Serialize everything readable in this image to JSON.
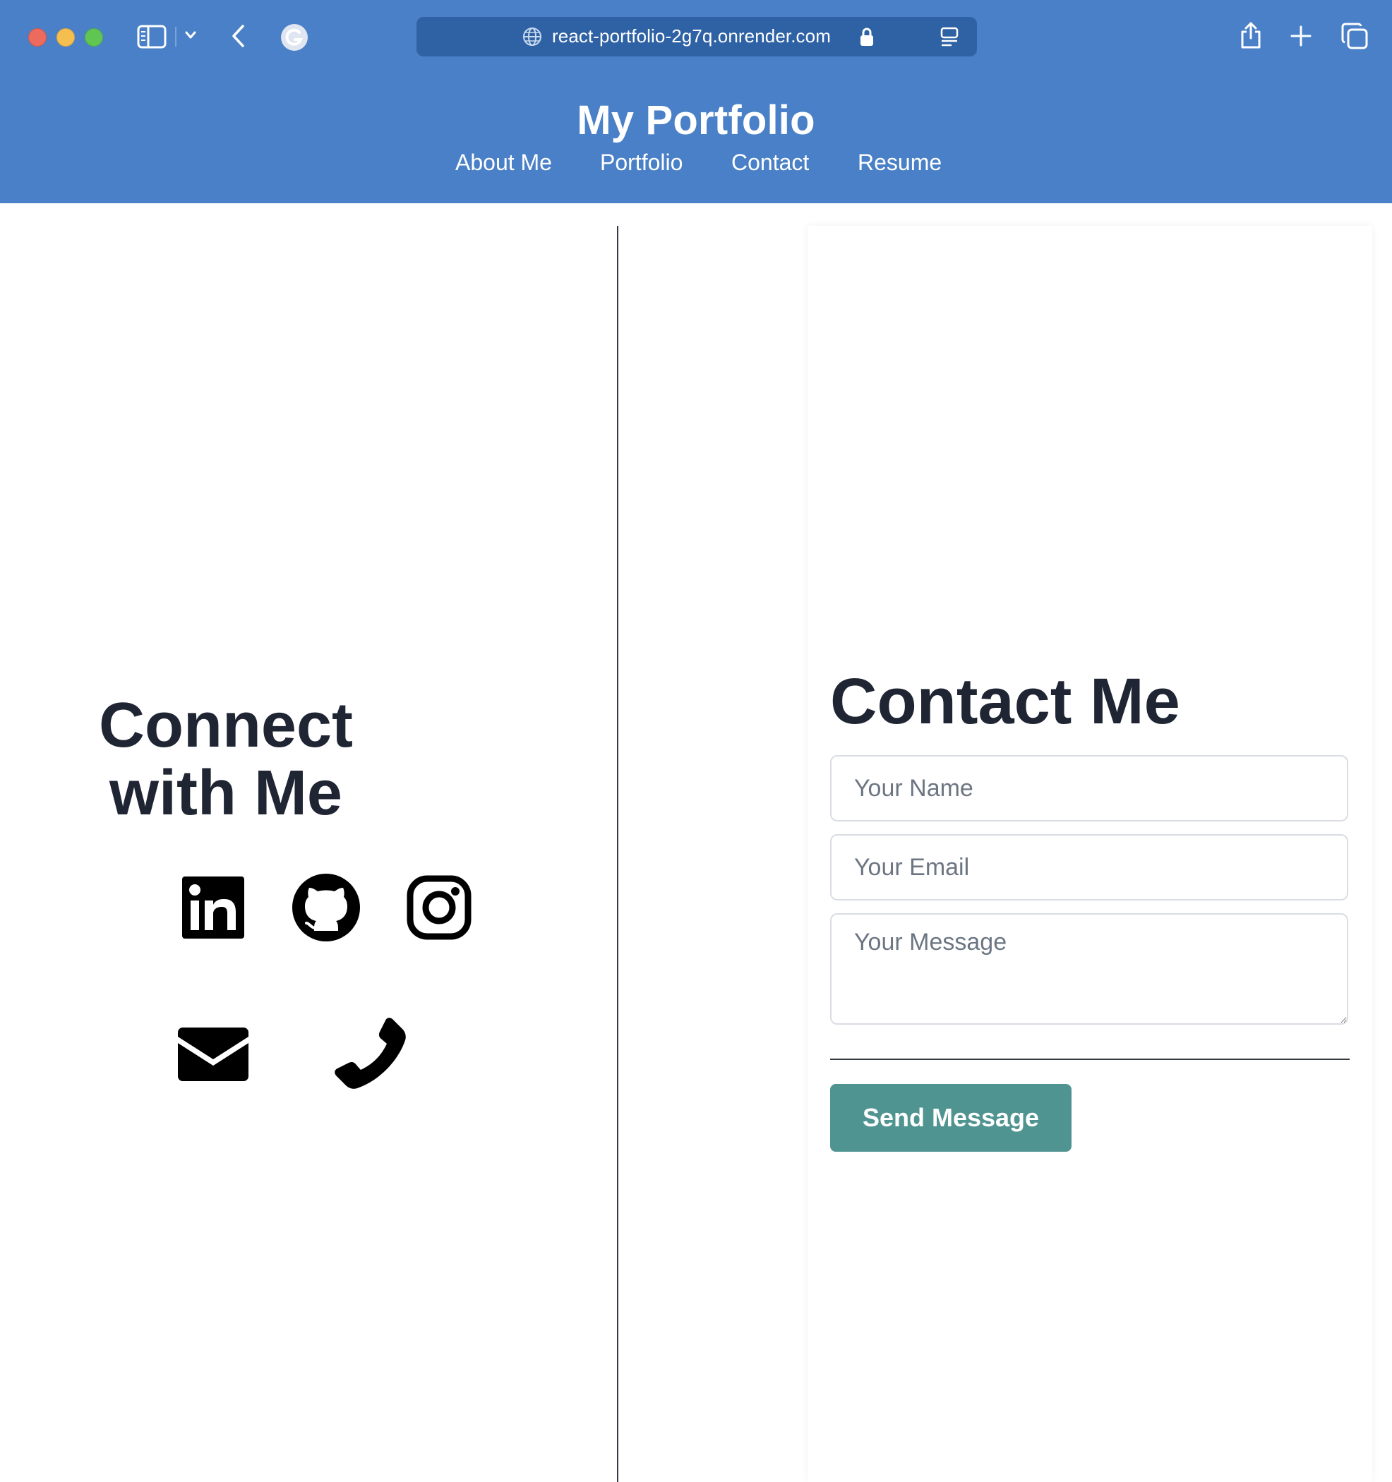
{
  "browser": {
    "url": "react-portfolio-2g7q.onrender.com",
    "icons": [
      "sidebar-icon",
      "chevron-down-icon",
      "back-icon",
      "grammarly-icon",
      "globe-icon",
      "lock-icon",
      "reader-icon",
      "share-icon",
      "plus-icon",
      "tabs-icon"
    ]
  },
  "header": {
    "title": "My Portfolio",
    "nav": [
      {
        "label": "About Me"
      },
      {
        "label": "Portfolio"
      },
      {
        "label": "Contact"
      },
      {
        "label": "Resume"
      }
    ]
  },
  "connect": {
    "heading_line1": "Connect",
    "heading_line2": "with Me",
    "icons": [
      "linkedin-icon",
      "github-icon",
      "instagram-icon",
      "email-icon",
      "phone-icon"
    ]
  },
  "contact": {
    "heading": "Contact Me",
    "name_placeholder": "Your Name",
    "email_placeholder": "Your Email",
    "message_placeholder": "Your Message",
    "send_label": "Send Message"
  },
  "colors": {
    "header_bg": "#4a80c7",
    "address_bar_bg": "#2e62a5",
    "button_bg": "#4f9490",
    "heading_text": "#1f2533"
  }
}
